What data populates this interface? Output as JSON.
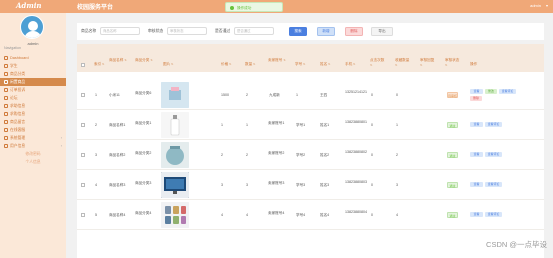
{
  "header": {
    "brand": "Admin",
    "title": "校园服务平台",
    "user": "admin",
    "chevron": "▾"
  },
  "toast": {
    "text": "操作成功"
  },
  "sidebar": {
    "admin_name": "admin",
    "nav_heading": "Navigation",
    "items": [
      {
        "label": "Dashboard"
      },
      {
        "label": "学生"
      },
      {
        "label": "商品分类"
      },
      {
        "label": "闲置商品"
      },
      {
        "label": "订单投诉"
      },
      {
        "label": "论坛"
      },
      {
        "label": "求助信息"
      },
      {
        "label": "求购信息"
      },
      {
        "label": "商品留言"
      },
      {
        "label": "在线客服"
      },
      {
        "label": "系统管理",
        "arrow": "›"
      },
      {
        "label": "用户信息",
        "arrow": "›"
      }
    ],
    "sub_items": [
      {
        "label": "修改密码"
      },
      {
        "label": "个人信息"
      }
    ]
  },
  "search": {
    "fields": [
      {
        "label": "商品名称",
        "placeholder": "商品名称"
      },
      {
        "label": "审核状态",
        "placeholder": "审核状态"
      },
      {
        "label": "是否通过",
        "placeholder": "是否通过"
      }
    ],
    "buttons": {
      "search": "搜索",
      "add": "新增",
      "delete": "删除",
      "export": "导出"
    }
  },
  "table": {
    "columns": [
      "索引",
      "商品名称",
      "商品分类",
      "图片",
      "价格",
      "数量",
      "卖家账号",
      "学号",
      "姓名",
      "手机",
      "点击次数",
      "收藏数量",
      "审核回复",
      "审核状态",
      "操作"
    ],
    "rows": [
      {
        "index": "1",
        "name": "小米11",
        "category": "商品分类6",
        "price": "1500",
        "qty": "2",
        "seller": "九成新",
        "sno": "1",
        "sname": "王四",
        "phone": "13251214121",
        "clicks": "0",
        "fav": "0",
        "reply": "",
        "status": "待审核",
        "status_kind": "todo",
        "image": "pink-gift"
      },
      {
        "index": "2",
        "name": "商品名称1",
        "category": "商品分类1",
        "price": "1",
        "qty": "1",
        "seller": "卖家账号1",
        "sno": "学号1",
        "sname": "姓名1",
        "phone": "13823880801",
        "clicks": "0",
        "fav": "1",
        "reply": "",
        "status": "通过",
        "status_kind": "ok",
        "image": "bottle"
      },
      {
        "index": "3",
        "name": "商品名称2",
        "category": "商品分类2",
        "price": "2",
        "qty": "2",
        "seller": "卖家账号2",
        "sno": "学号2",
        "sname": "姓名2",
        "phone": "13823880802",
        "clicks": "0",
        "fav": "2",
        "reply": "",
        "status": "通过",
        "status_kind": "ok",
        "image": "jar"
      },
      {
        "index": "4",
        "name": "商品名称3",
        "category": "商品分类3",
        "price": "3",
        "qty": "3",
        "seller": "卖家账号3",
        "sno": "学号3",
        "sname": "姓名3",
        "phone": "13823880803",
        "clicks": "0",
        "fav": "3",
        "reply": "",
        "status": "通过",
        "status_kind": "ok",
        "image": "tv"
      },
      {
        "index": "5",
        "name": "商品名称4",
        "category": "商品分类4",
        "price": "4",
        "qty": "4",
        "seller": "卖家账号4",
        "sno": "学号4",
        "sname": "姓名4",
        "phone": "13823880804",
        "clicks": "0",
        "fav": "4",
        "reply": "",
        "status": "通过",
        "status_kind": "ok",
        "image": "cups"
      }
    ],
    "ops": {
      "view": "查看",
      "edit": "修改",
      "comment": "查看评论",
      "delete": "删除"
    }
  },
  "watermark": "CSDN @一点毕设"
}
